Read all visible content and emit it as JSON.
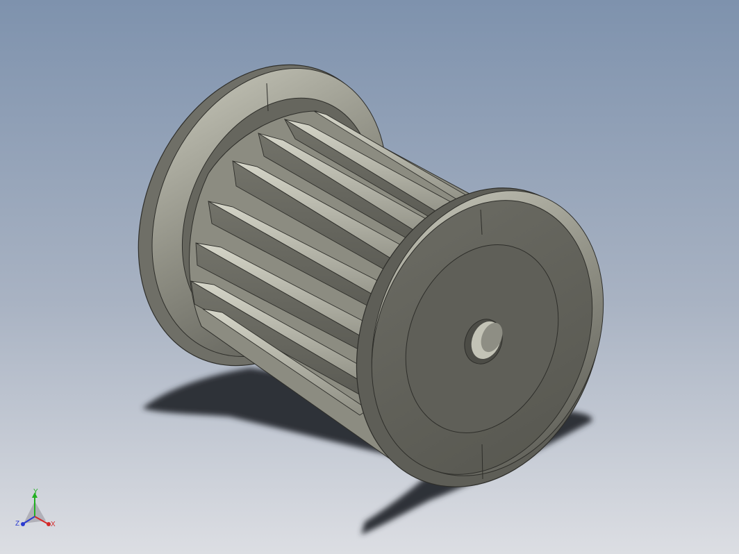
{
  "viewport": {
    "background_top": "#7f93ad",
    "background_bottom": "#d8dbe1",
    "shadow_color": "#2c2f37",
    "part_color": "#8b8b80",
    "part_face_color": "#5e5e58"
  },
  "orientation_triad": {
    "axes": [
      {
        "name": "X",
        "color": "#d42828"
      },
      {
        "name": "Y",
        "color": "#22b022"
      },
      {
        "name": "Z",
        "color": "#2a3ad0"
      }
    ]
  }
}
